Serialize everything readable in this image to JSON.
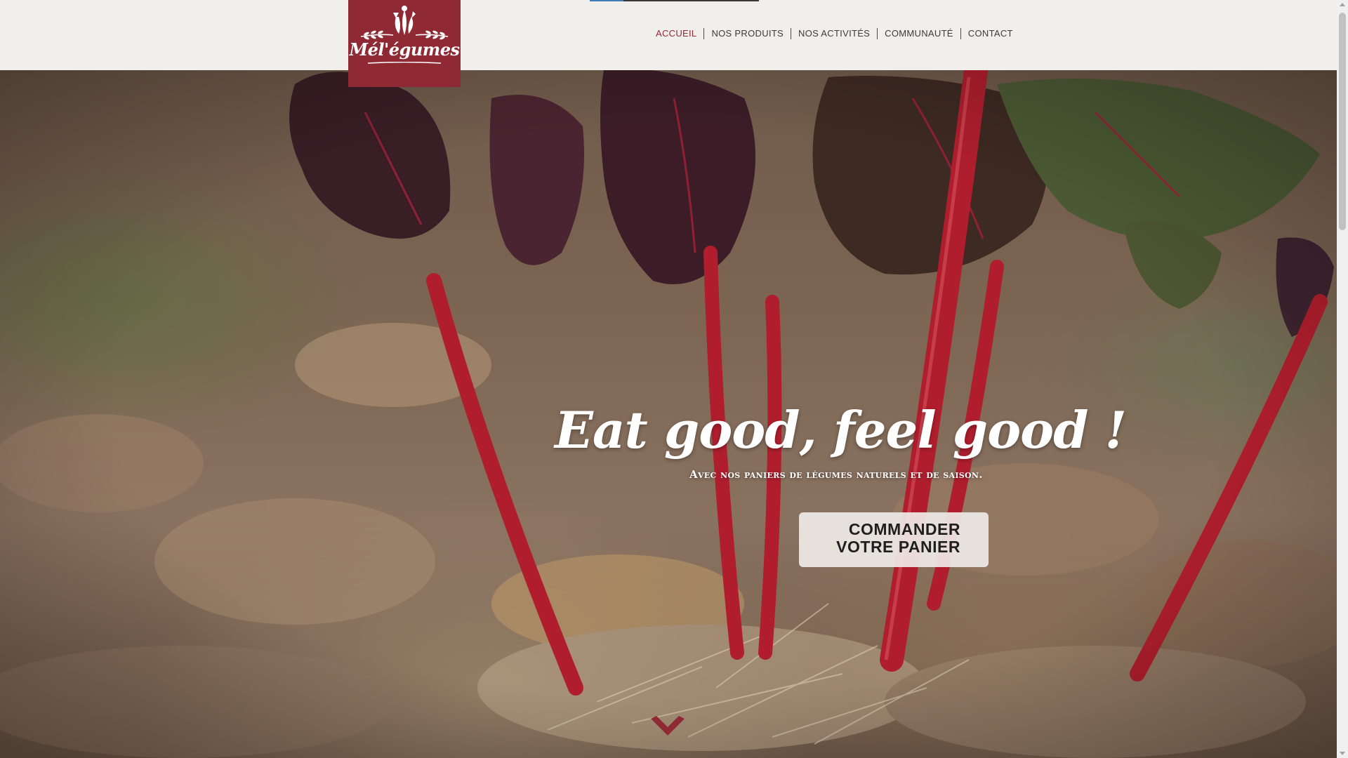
{
  "brand": {
    "logo_text": "Mél'égumes",
    "logo_color": "#8f2a35"
  },
  "nav": {
    "items": [
      {
        "label": "ACCUEIL",
        "active": true
      },
      {
        "label": "NOS PRODUITS",
        "active": false
      },
      {
        "label": "NOS ACTIVITÉS",
        "active": false
      },
      {
        "label": "COMMUNAUTÉ",
        "active": false
      },
      {
        "label": "CONTACT",
        "active": false
      }
    ],
    "active_color": "#8f2a35"
  },
  "hero": {
    "title": "Eat good, feel good !",
    "subtitle": "Avec nos paniers de légumes naturels et de saison.",
    "cta": {
      "line1": "COMMANDER",
      "line2": "VOTRE PANIER"
    },
    "scroll_icon": "chevron-down-icon",
    "scroll_icon_color": "#8f2a35",
    "background": "photo of red-stemmed chard among dry leaves"
  },
  "colors": {
    "header_bg": "#f1efec",
    "accent": "#8f2a35",
    "stem_red": "#b01e2e"
  }
}
